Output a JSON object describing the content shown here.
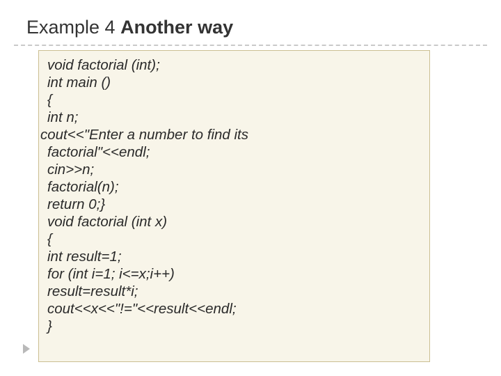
{
  "title": {
    "plain": "Example 4 ",
    "bold": "Another way"
  },
  "code": {
    "l1": "void factorial (int);",
    "l2": "int main ()",
    "l3": "{",
    "l4": "int n;",
    "l5": "cout<<\"Enter a number to find its",
    "l6": "factorial\"<<endl;",
    "l7": "cin>>n;",
    "l8": "factorial(n);",
    "l9": "return 0;}",
    "l10": "void factorial (int x)",
    "l11": "{",
    "l12": "int result=1;",
    "l13": "for (int i=1; i<=x;i++)",
    "l14": "result=result*i;",
    "l15": "cout<<x<<\"!=\"<<result<<endl;",
    "l16": "}"
  }
}
